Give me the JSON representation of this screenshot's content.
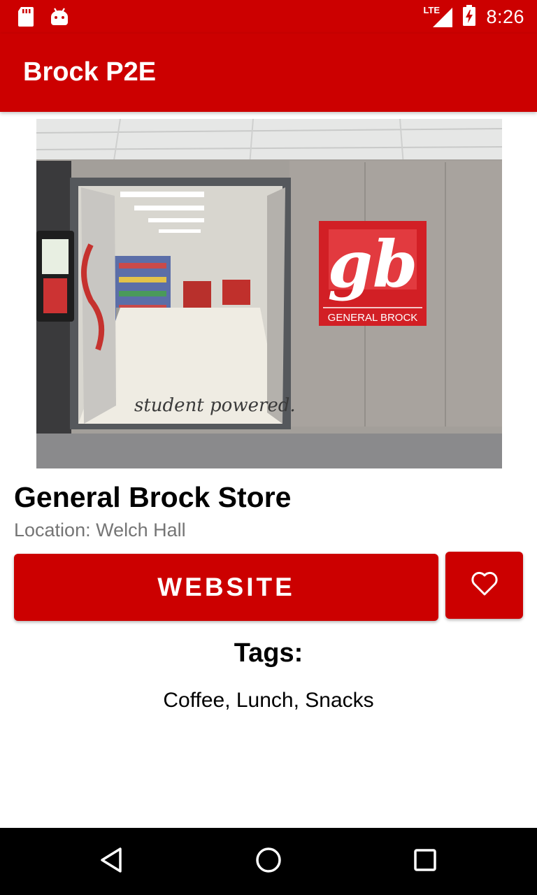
{
  "status_bar": {
    "time": "8:26",
    "network": "LTE",
    "icons": [
      "sd-card-icon",
      "android-debug-icon",
      "lte-signal-icon",
      "battery-charging-icon"
    ]
  },
  "app_bar": {
    "title": "Brock P2E"
  },
  "store": {
    "photo_sign_text": "GENERAL BROCK",
    "photo_floor_text": "student powered.",
    "name": "General Brock Store",
    "location": "Location: Welch Hall",
    "website_label": "WEBSITE",
    "favorite_icon": "heart-outline-icon"
  },
  "tags": {
    "heading": "Tags:",
    "list": "Coffee, Lunch, Snacks"
  },
  "nav_bar": {
    "icons": [
      "back-icon",
      "home-icon",
      "recents-icon"
    ]
  },
  "colors": {
    "primary": "#cc0000",
    "secondary_text": "#757575",
    "nav_background": "#000000"
  }
}
